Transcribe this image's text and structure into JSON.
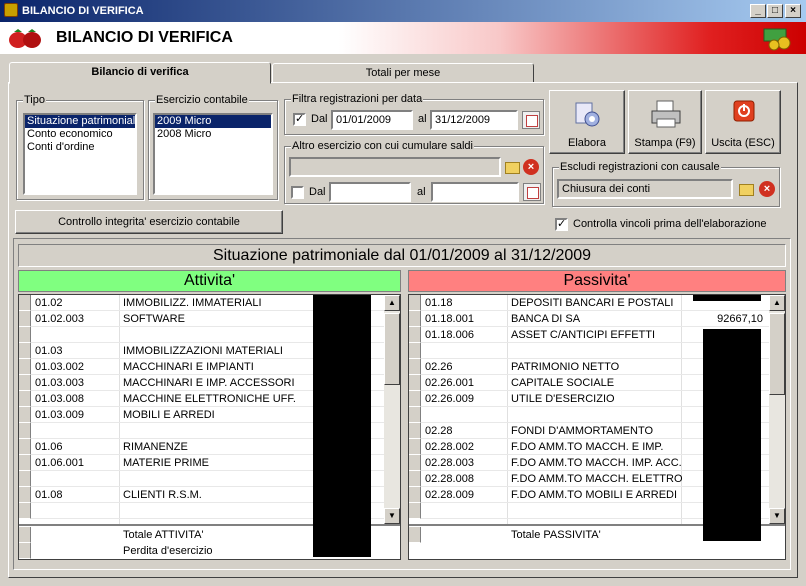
{
  "window": {
    "title": "BILANCIO DI VERIFICA",
    "minimize": "_",
    "maximize": "□",
    "close": "×"
  },
  "header": {
    "title": "BILANCIO DI VERIFICA"
  },
  "tabs": [
    {
      "label": "Bilancio di verifica"
    },
    {
      "label": "Totali per mese"
    }
  ],
  "tipo": {
    "label": "Tipo",
    "items": [
      "Situazione patrimoniale",
      "Conto economico",
      "Conti d'ordine"
    ]
  },
  "esercizio": {
    "label": "Esercizio contabile",
    "items": [
      "2009 Micro",
      "2008 Micro"
    ]
  },
  "filtra": {
    "label": "Filtra registrazioni per data",
    "dal_label": "Dal",
    "dal_value": "01/01/2009",
    "al_label": "al",
    "al_value": "31/12/2009",
    "checked": "✓"
  },
  "altro": {
    "label": "Altro esercizio con cui cumulare saldi",
    "dal_label": "Dal",
    "al_label": "al"
  },
  "buttons": {
    "elabora": "Elabora",
    "stampa": "Stampa (F9)",
    "uscita": "Uscita (ESC)"
  },
  "escludi": {
    "label": "Escludi registrazioni con causale",
    "value": "Chiusura dei conti"
  },
  "controllo_button": "Controllo integrita' esercizio contabile",
  "controlla_vincoli": {
    "label": "Controlla vincoli prima dell'elaborazione",
    "checked": "✓"
  },
  "report": {
    "title": "Situazione patrimoniale dal 01/01/2009 al 31/12/2009",
    "attivita": {
      "header": "Attivita'",
      "rows": [
        {
          "code": "01.02",
          "desc": "IMMOBILIZZ. IMMATERIALI"
        },
        {
          "code": "01.02.003",
          "desc": "SOFTWARE"
        },
        {
          "code": "",
          "desc": ""
        },
        {
          "code": "01.03",
          "desc": "IMMOBILIZZAZIONI MATERIALI"
        },
        {
          "code": "01.03.002",
          "desc": "MACCHINARI E IMPIANTI"
        },
        {
          "code": "01.03.003",
          "desc": "MACCHINARI E IMP. ACCESSORI"
        },
        {
          "code": "01.03.008",
          "desc": "MACCHINE ELETTRONICHE UFF."
        },
        {
          "code": "01.03.009",
          "desc": "MOBILI E ARREDI"
        },
        {
          "code": "",
          "desc": ""
        },
        {
          "code": "01.06",
          "desc": "RIMANENZE"
        },
        {
          "code": "01.06.001",
          "desc": "MATERIE PRIME"
        },
        {
          "code": "",
          "desc": ""
        },
        {
          "code": "01.08",
          "desc": "CLIENTI R.S.M."
        },
        {
          "code": "",
          "desc": ""
        }
      ],
      "footer": [
        {
          "desc": "Totale ATTIVITA'"
        },
        {
          "desc": "Perdita d'esercizio"
        }
      ]
    },
    "passivita": {
      "header": "Passivita'",
      "rows": [
        {
          "code": "01.18",
          "desc": "DEPOSITI BANCARI E POSTALI",
          "value": ""
        },
        {
          "code": "01.18.001",
          "desc": "BANCA DI SA",
          "value": "92667,10"
        },
        {
          "code": "01.18.006",
          "desc": "ASSET C/ANTICIPI EFFETTI",
          "value": ""
        },
        {
          "code": "",
          "desc": "",
          "value": ""
        },
        {
          "code": "02.26",
          "desc": "PATRIMONIO NETTO",
          "value": ""
        },
        {
          "code": "02.26.001",
          "desc": "CAPITALE SOCIALE",
          "value": ""
        },
        {
          "code": "02.26.009",
          "desc": "UTILE D'ESERCIZIO",
          "value": ""
        },
        {
          "code": "",
          "desc": "",
          "value": ""
        },
        {
          "code": "02.28",
          "desc": "FONDI D'AMMORTAMENTO",
          "value": ""
        },
        {
          "code": "02.28.002",
          "desc": "F.DO AMM.TO MACCH. E IMP.",
          "value": ""
        },
        {
          "code": "02.28.003",
          "desc": "F.DO AMM.TO MACCH. IMP. ACC.",
          "value": ""
        },
        {
          "code": "02.28.008",
          "desc": "F.DO AMM.TO MACCH. ELETTRO",
          "value": ""
        },
        {
          "code": "02.28.009",
          "desc": "F.DO AMM.TO MOBILI E ARREDI",
          "value": ""
        },
        {
          "code": "",
          "desc": "",
          "value": ""
        }
      ],
      "footer": [
        {
          "desc": "Totale PASSIVITA'"
        }
      ]
    }
  },
  "colors": {
    "attivita": "#80ff80",
    "passivita": "#ff8080",
    "selection": "#0a246a"
  }
}
